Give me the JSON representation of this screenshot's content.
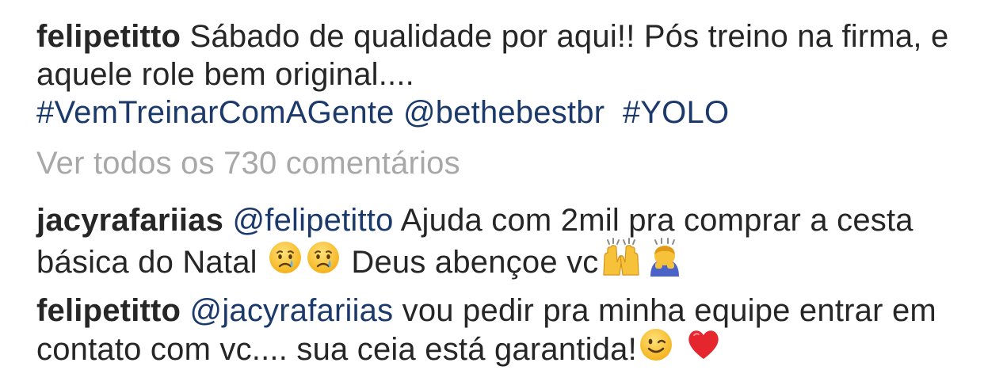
{
  "post": {
    "caption": {
      "username": "felipetitto",
      "text": "Sábado de qualidade por aqui!! Pós treino na firma, e aquele role bem original....",
      "hashtag_1": "#VemTreinarComAGente",
      "mention": "@bethebestbr",
      "hashtag_2": "#YOLO"
    },
    "view_all_comments": "Ver todos os 730 comentários"
  },
  "comments": [
    {
      "username": "jacyrafariias",
      "mention": "@felipetitto",
      "text_1": "Ajuda com 2mil pra comprar a cesta básica do Natal",
      "text_2": "Deus abençoe vc",
      "emojis": [
        "crying-face",
        "crying-face",
        "raising-hands",
        "person-bowing"
      ]
    },
    {
      "username": "felipetitto",
      "mention": "@jacyrafariias",
      "text": "vou pedir pra minha equipe entrar em contato com vc.... sua ceia está garantida!",
      "emojis": [
        "winking-face",
        "red-heart"
      ]
    }
  ],
  "colors": {
    "text": "#262626",
    "link": "#1b3a6b",
    "muted": "#a8a8a8"
  }
}
